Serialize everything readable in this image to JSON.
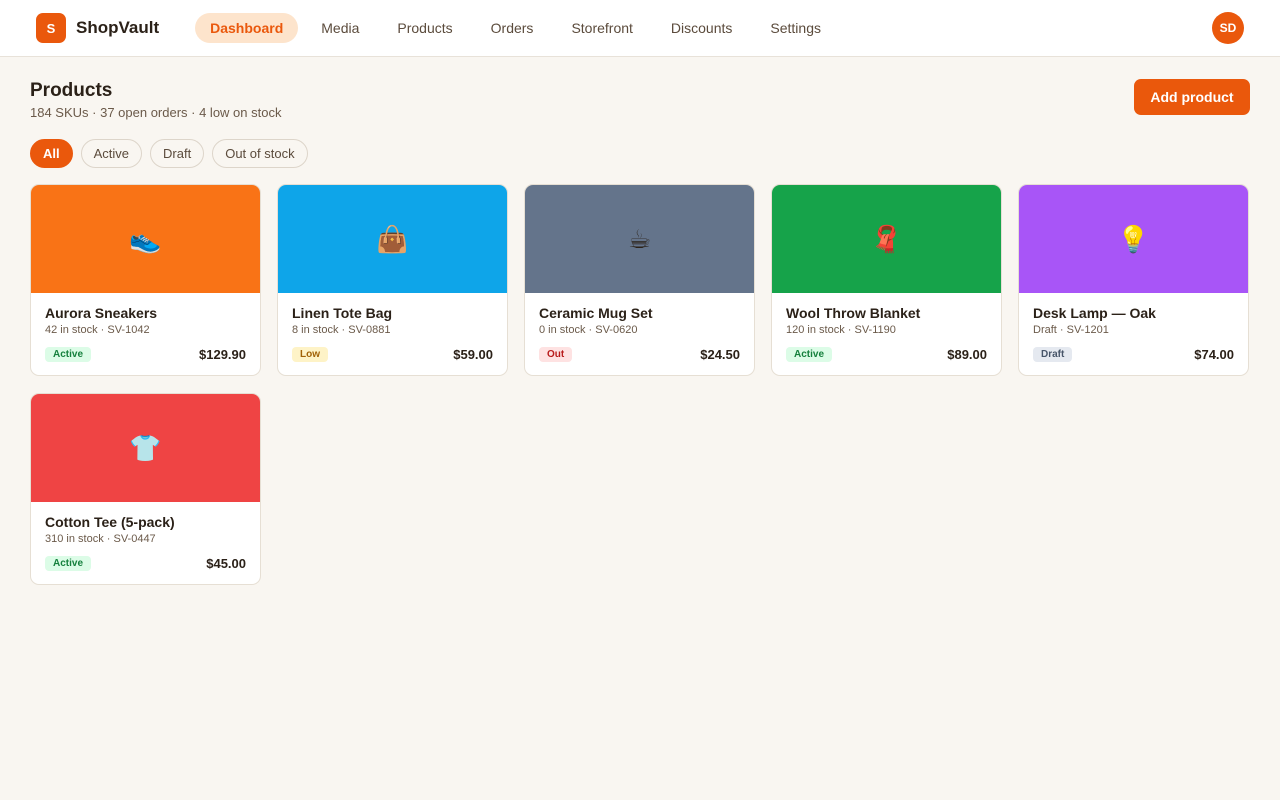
{
  "app": {
    "logo_letter": "S",
    "name": "ShopVault"
  },
  "nav": [
    {
      "label": "Dashboard",
      "active": true
    },
    {
      "label": "Media",
      "active": false
    },
    {
      "label": "Products",
      "active": false
    },
    {
      "label": "Orders",
      "active": false
    },
    {
      "label": "Storefront",
      "active": false
    },
    {
      "label": "Discounts",
      "active": false
    },
    {
      "label": "Settings",
      "active": false
    }
  ],
  "user": {
    "initials": "SD"
  },
  "header": {
    "title": "Products",
    "subtitle": "184 SKUs · 37 open orders · 4 low on stock",
    "add_button": "Add product"
  },
  "filters": [
    {
      "label": "All",
      "active": true
    },
    {
      "label": "Active",
      "active": false
    },
    {
      "label": "Draft",
      "active": false
    },
    {
      "label": "Out of stock",
      "active": false
    }
  ],
  "products": [
    {
      "name": "Aurora Sneakers",
      "meta": "42 in stock · SV-1042",
      "status": "Active",
      "status_kind": "active",
      "price": "$129.90",
      "color": "#f97316",
      "icon": "sneaker-icon",
      "glyph": "👟"
    },
    {
      "name": "Linen Tote Bag",
      "meta": "8 in stock · SV-0881",
      "status": "Low",
      "status_kind": "low",
      "price": "$59.00",
      "color": "#0ea5e9",
      "icon": "handbag-icon",
      "glyph": "👜"
    },
    {
      "name": "Ceramic Mug Set",
      "meta": "0 in stock · SV-0620",
      "status": "Out",
      "status_kind": "out",
      "price": "$24.50",
      "color": "#64748b",
      "icon": "coffee-mug-icon",
      "glyph": "☕"
    },
    {
      "name": "Wool Throw Blanket",
      "meta": "120 in stock · SV-1190",
      "status": "Active",
      "status_kind": "active",
      "price": "$89.00",
      "color": "#16a34a",
      "icon": "scarf-icon",
      "glyph": "🧣"
    },
    {
      "name": "Desk Lamp — Oak",
      "meta": "Draft · SV-1201",
      "status": "Draft",
      "status_kind": "draft",
      "price": "$74.00",
      "color": "#a855f7",
      "icon": "light-bulb-icon",
      "glyph": "💡"
    },
    {
      "name": "Cotton Tee (5-pack)",
      "meta": "310 in stock · SV-0447",
      "status": "Active",
      "status_kind": "active",
      "price": "$45.00",
      "color": "#ef4444",
      "icon": "t-shirt-icon",
      "glyph": "👕"
    }
  ]
}
